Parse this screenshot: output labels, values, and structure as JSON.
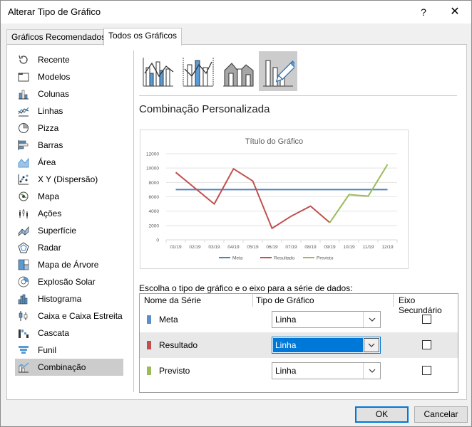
{
  "window": {
    "title": "Alterar Tipo de Gráfico",
    "help": "?",
    "close": "✕"
  },
  "tabs": [
    {
      "label": "Gráficos Recomendados",
      "active": false
    },
    {
      "label": "Todos os Gráficos",
      "active": true
    }
  ],
  "sidebar": {
    "items": [
      {
        "label": "Recente",
        "icon": "recent-icon"
      },
      {
        "label": "Modelos",
        "icon": "folder-icon"
      },
      {
        "label": "Colunas",
        "icon": "column-chart-icon"
      },
      {
        "label": "Linhas",
        "icon": "line-chart-icon"
      },
      {
        "label": "Pizza",
        "icon": "pie-chart-icon"
      },
      {
        "label": "Barras",
        "icon": "bar-chart-icon"
      },
      {
        "label": "Área",
        "icon": "area-chart-icon"
      },
      {
        "label": "X Y (Dispersão)",
        "icon": "scatter-chart-icon"
      },
      {
        "label": "Mapa",
        "icon": "map-chart-icon"
      },
      {
        "label": "Ações",
        "icon": "stock-chart-icon"
      },
      {
        "label": "Superfície",
        "icon": "surface-chart-icon"
      },
      {
        "label": "Radar",
        "icon": "radar-chart-icon"
      },
      {
        "label": "Mapa de Árvore",
        "icon": "treemap-chart-icon"
      },
      {
        "label": "Explosão Solar",
        "icon": "sunburst-chart-icon"
      },
      {
        "label": "Histograma",
        "icon": "histogram-chart-icon"
      },
      {
        "label": "Caixa e Caixa Estreita",
        "icon": "box-whisker-chart-icon"
      },
      {
        "label": "Cascata",
        "icon": "waterfall-chart-icon"
      },
      {
        "label": "Funil",
        "icon": "funnel-chart-icon"
      },
      {
        "label": "Combinação",
        "icon": "combo-chart-icon",
        "selected": true
      }
    ]
  },
  "main": {
    "heading": "Combinação Personalizada",
    "series_prompt": "Escolha o tipo de gráfico e o eixo para a série de dados:",
    "columns": {
      "name": "Nome da Série",
      "type": "Tipo de Gráfico",
      "secondary": "Eixo Secundário"
    },
    "series": [
      {
        "name": "Meta",
        "type": "Linha",
        "color": "#5b8fc7",
        "secondary": false
      },
      {
        "name": "Resultado",
        "type": "Linha",
        "color": "#c0504d",
        "secondary": false,
        "focused": true
      },
      {
        "name": "Previsto",
        "type": "Linha",
        "color": "#9bbb59",
        "secondary": false
      }
    ]
  },
  "chart_data": {
    "type": "line",
    "title": "Título do Gráfico",
    "categories": [
      "01/19",
      "02/19",
      "03/19",
      "04/19",
      "05/19",
      "06/19",
      "07/19",
      "08/19",
      "09/19",
      "10/19",
      "11/19",
      "12/19"
    ],
    "ylim": [
      0,
      12000
    ],
    "yticks": [
      "0",
      "2000",
      "4000",
      "6000",
      "8000",
      "10000",
      "12000"
    ],
    "grid": true,
    "legend_position": "bottom",
    "series": [
      {
        "name": "Meta",
        "color": "#4f81bd",
        "values": [
          7000,
          7000,
          7000,
          7000,
          7000,
          7000,
          7000,
          7000,
          7000,
          7000,
          7000,
          7000
        ]
      },
      {
        "name": "Resultado",
        "color": "#c0504d",
        "values": [
          9400,
          7200,
          5000,
          9900,
          8200,
          1600,
          3300,
          4700,
          2400,
          null,
          null,
          null
        ]
      },
      {
        "name": "Previsto",
        "color": "#9bbb59",
        "values": [
          null,
          null,
          null,
          null,
          null,
          null,
          null,
          null,
          2400,
          6300,
          6100,
          10500
        ]
      }
    ]
  },
  "footer": {
    "ok": "OK",
    "cancel": "Cancelar"
  }
}
